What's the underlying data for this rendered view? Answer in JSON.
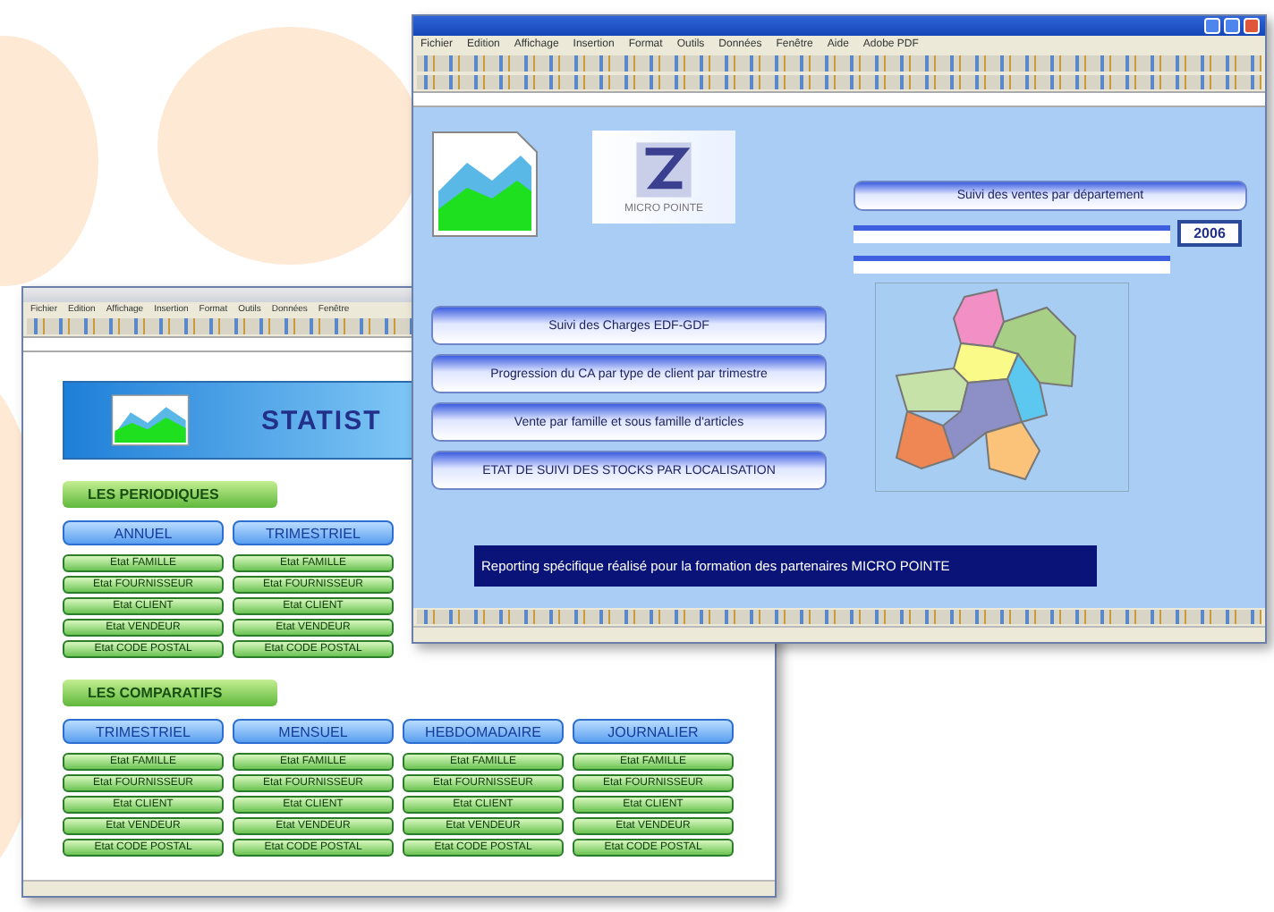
{
  "back_window": {
    "menu": [
      "Fichier",
      "Edition",
      "Affichage",
      "Insertion",
      "Format",
      "Outils",
      "Données",
      "Fenêtre"
    ],
    "banner_title": "STATIST",
    "sections": [
      {
        "title": "LES PERIODIQUES",
        "columns": [
          {
            "heading": "ANNUEL",
            "items": [
              "Etat FAMILLE",
              "Etat FOURNISSEUR",
              "Etat CLIENT",
              "Etat VENDEUR",
              "Etat CODE POSTAL"
            ]
          },
          {
            "heading": "TRIMESTRIEL",
            "items": [
              "Etat FAMILLE",
              "Etat FOURNISSEUR",
              "Etat CLIENT",
              "Etat VENDEUR",
              "Etat CODE POSTAL"
            ]
          }
        ]
      },
      {
        "title": "LES COMPARATIFS",
        "columns": [
          {
            "heading": "TRIMESTRIEL",
            "items": [
              "Etat FAMILLE",
              "Etat FOURNISSEUR",
              "Etat CLIENT",
              "Etat VENDEUR",
              "Etat CODE POSTAL"
            ]
          },
          {
            "heading": "MENSUEL",
            "items": [
              "Etat FAMILLE",
              "Etat FOURNISSEUR",
              "Etat CLIENT",
              "Etat VENDEUR",
              "Etat CODE POSTAL"
            ]
          },
          {
            "heading": "HEBDOMADAIRE",
            "items": [
              "Etat FAMILLE",
              "Etat FOURNISSEUR",
              "Etat CLIENT",
              "Etat VENDEUR",
              "Etat CODE POSTAL"
            ]
          },
          {
            "heading": "JOURNALIER",
            "items": [
              "Etat FAMILLE",
              "Etat FOURNISSEUR",
              "Etat CLIENT",
              "Etat VENDEUR",
              "Etat CODE POSTAL"
            ]
          }
        ]
      }
    ]
  },
  "front_window": {
    "menu": [
      "Fichier",
      "Edition",
      "Affichage",
      "Insertion",
      "Format",
      "Outils",
      "Données",
      "Fenêtre",
      "Aide",
      "Adobe PDF"
    ],
    "logo_caption": "MICRO POINTE",
    "department_button": "Suivi des ventes par département",
    "year": "2006",
    "report_buttons": [
      "Suivi des Charges EDF-GDF",
      "Progression du CA par type de client par trimestre",
      "Vente par famille et sous famille d'articles",
      "ETAT DE SUIVI DES STOCKS PAR LOCALISATION"
    ],
    "banner": "Reporting spécifique réalisé pour la formation des partenaires MICRO POINTE"
  }
}
